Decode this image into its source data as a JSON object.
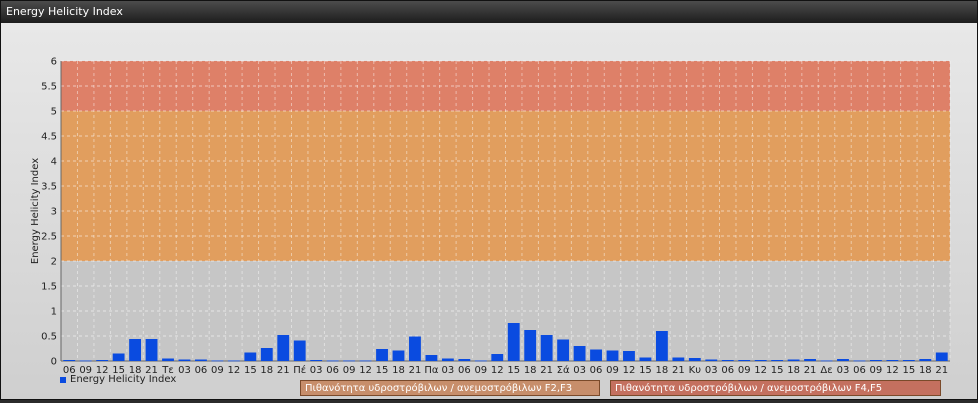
{
  "window": {
    "title": "Energy Helicity Index"
  },
  "legend": {
    "series_label": "Energy Helicity Index",
    "color": "#0a4be0"
  },
  "bands": [
    {
      "label": "Πιθανότητα υδροστρόβιλων / ανεμοστρόβιλων F2,F3",
      "from": 2,
      "to": 5,
      "color": "#e39a55"
    },
    {
      "label": "Πιθανότητα υδροστρόβιλων / ανεμοστρόβιλων F4,F5",
      "from": 5,
      "to": 6,
      "color": "#e07a60"
    }
  ],
  "chart_data": {
    "type": "bar",
    "title": "",
    "ylabel": "Energy Helicity Index",
    "xlabel": "",
    "ylim": [
      0,
      6
    ],
    "yticks": [
      "0",
      "0.5",
      "1",
      "1.5",
      "2",
      "2.5",
      "3",
      "3.5",
      "4",
      "4.5",
      "5",
      "5.5",
      "6"
    ],
    "grid": true,
    "categories": [
      "06",
      "09",
      "12",
      "15",
      "18",
      "21",
      "Τε",
      "03",
      "06",
      "09",
      "12",
      "15",
      "18",
      "21",
      "Πέ",
      "03",
      "06",
      "09",
      "12",
      "15",
      "18",
      "21",
      "Πα",
      "03",
      "06",
      "09",
      "12",
      "15",
      "18",
      "21",
      "Σά",
      "03",
      "06",
      "09",
      "12",
      "15",
      "18",
      "21",
      "Κυ",
      "03",
      "06",
      "09",
      "12",
      "15",
      "18",
      "21",
      "Δε",
      "03",
      "06",
      "09",
      "12",
      "15",
      "18",
      "21"
    ],
    "series": [
      {
        "name": "Energy Helicity Index",
        "values": [
          0.02,
          0.01,
          0.02,
          0.15,
          0.44,
          0.44,
          0.05,
          0.03,
          0.03,
          0.01,
          0.01,
          0.17,
          0.26,
          0.52,
          0.41,
          0.02,
          0.01,
          0.01,
          0.01,
          0.24,
          0.21,
          0.49,
          0.12,
          0.05,
          0.04,
          0.01,
          0.14,
          0.76,
          0.62,
          0.52,
          0.43,
          0.3,
          0.23,
          0.21,
          0.2,
          0.07,
          0.6,
          0.07,
          0.06,
          0.03,
          0.02,
          0.02,
          0.02,
          0.02,
          0.03,
          0.04,
          0.01,
          0.04,
          0.01,
          0.02,
          0.02,
          0.02,
          0.04,
          0.17
        ]
      }
    ]
  }
}
